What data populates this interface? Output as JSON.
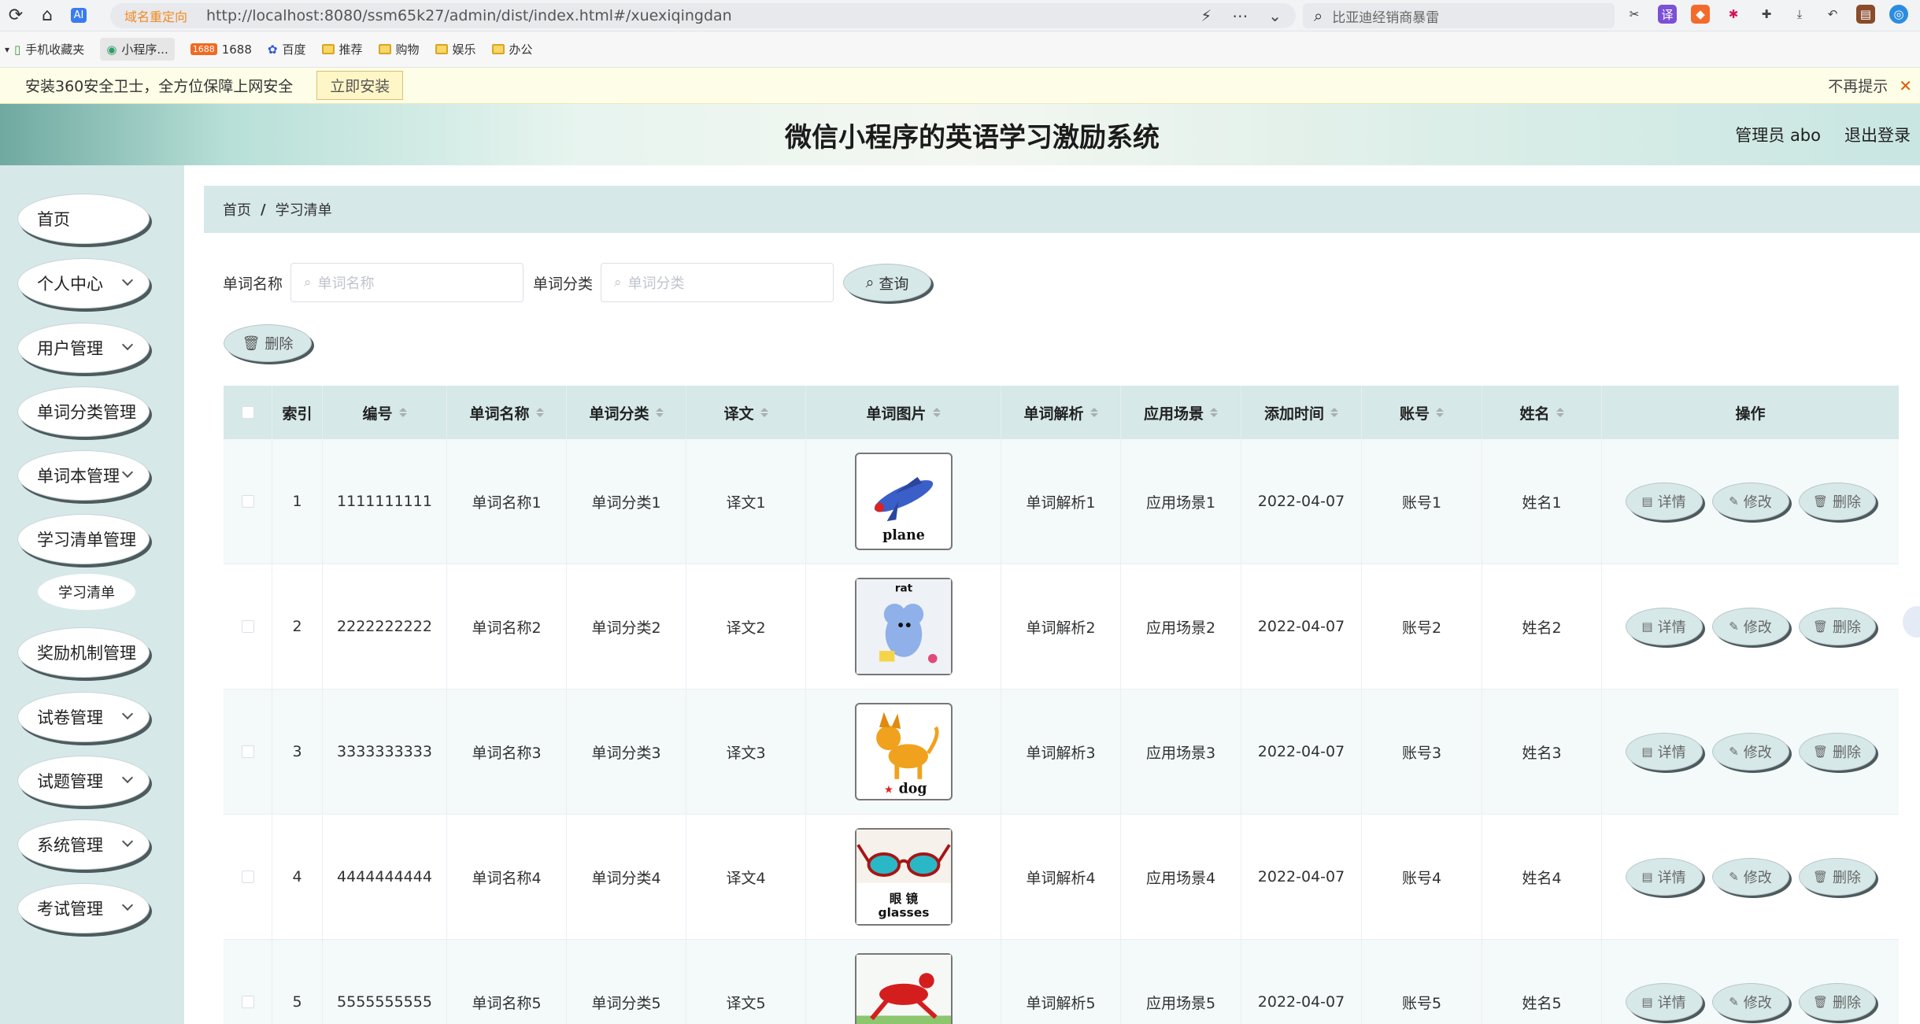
{
  "browser": {
    "url_tag": "域名重定向",
    "url": "http://localhost:8080/ssm65k27/admin/dist/index.html#/xuexiqingdan",
    "search_placeholder": "比亚迪经销商暴雷",
    "bookmarks": [
      "手机收藏夹",
      "小程序...",
      "1688",
      "百度",
      "推荐",
      "购物",
      "娱乐",
      "办公"
    ],
    "notice_text": "安装360安全卫士，全方位保障上网安全",
    "notice_button": "立即安装",
    "notice_dismiss": "不再提示"
  },
  "header": {
    "title": "微信小程序的英语学习激励系统",
    "user": "管理员 abo",
    "logout": "退出登录"
  },
  "sidebar": {
    "items": [
      {
        "label": "首页",
        "has_children": false
      },
      {
        "label": "个人中心",
        "has_children": true
      },
      {
        "label": "用户管理",
        "has_children": true
      },
      {
        "label": "单词分类管理",
        "has_children": true
      },
      {
        "label": "单词本管理",
        "has_children": true
      },
      {
        "label": "学习清单管理",
        "has_children": true
      },
      {
        "label": "奖励机制管理",
        "has_children": true
      },
      {
        "label": "试卷管理",
        "has_children": true
      },
      {
        "label": "试题管理",
        "has_children": true
      },
      {
        "label": "系统管理",
        "has_children": true
      },
      {
        "label": "考试管理",
        "has_children": true
      }
    ],
    "sub_item": "学习清单"
  },
  "breadcrumb": {
    "home": "首页",
    "current": "学习清单"
  },
  "filters": {
    "word_name_label": "单词名称",
    "word_name_placeholder": "单词名称",
    "word_category_label": "单词分类",
    "word_category_placeholder": "单词分类",
    "query_button": "查询",
    "delete_button": "删除"
  },
  "table": {
    "columns": [
      "索引",
      "编号",
      "单词名称",
      "单词分类",
      "译文",
      "单词图片",
      "单词解析",
      "应用场景",
      "添加时间",
      "账号",
      "姓名",
      "操作"
    ],
    "actions": {
      "detail": "详情",
      "edit": "修改",
      "delete": "删除"
    },
    "rows": [
      {
        "index": "1",
        "code": "1111111111",
        "name": "单词名称1",
        "category": "单词分类1",
        "translation": "译文1",
        "image_word": "plane",
        "analysis": "单词解析1",
        "scene": "应用场景1",
        "date": "2022-04-07",
        "account": "账号1",
        "fullname": "姓名1"
      },
      {
        "index": "2",
        "code": "2222222222",
        "name": "单词名称2",
        "category": "单词分类2",
        "translation": "译文2",
        "image_word": "rat",
        "analysis": "单词解析2",
        "scene": "应用场景2",
        "date": "2022-04-07",
        "account": "账号2",
        "fullname": "姓名2"
      },
      {
        "index": "3",
        "code": "3333333333",
        "name": "单词名称3",
        "category": "单词分类3",
        "translation": "译文3",
        "image_word": "dog",
        "analysis": "单词解析3",
        "scene": "应用场景3",
        "date": "2022-04-07",
        "account": "账号3",
        "fullname": "姓名3"
      },
      {
        "index": "4",
        "code": "4444444444",
        "name": "单词名称4",
        "category": "单词分类4",
        "translation": "译文4",
        "image_word": "眼镜 glasses",
        "analysis": "单词解析4",
        "scene": "应用场景4",
        "date": "2022-04-07",
        "account": "账号4",
        "fullname": "姓名4"
      },
      {
        "index": "5",
        "code": "5555555555",
        "name": "单词名称5",
        "category": "单词分类5",
        "translation": "译文5",
        "image_word": "",
        "analysis": "单词解析5",
        "scene": "应用场景5",
        "date": "2022-04-07",
        "account": "账号5",
        "fullname": "姓名5"
      }
    ]
  },
  "colors": {
    "accent": "#d6e8e8",
    "shadow": "#4d5a5e",
    "header_gradient_end": "#c9e6e2"
  }
}
